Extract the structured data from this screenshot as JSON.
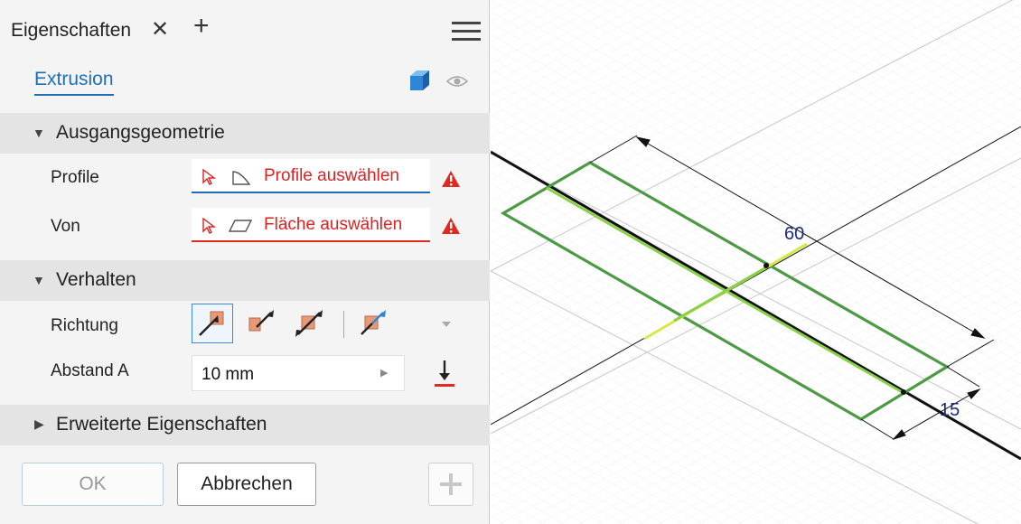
{
  "panel": {
    "tab_title": "Eigenschaften",
    "close_icon": "close-icon",
    "add_icon": "plus-icon",
    "menu_icon": "hamburger-menu-icon",
    "feature_tab": "Extrusion",
    "accent_color": "#1e6fb8",
    "error_color": "#dd2222"
  },
  "sections": {
    "input_geometry": {
      "title": "Ausgangsgeometrie",
      "profile_label": "Profile",
      "profile_value": "Profile auswählen",
      "from_label": "Von",
      "from_value": "Fläche auswählen"
    },
    "behavior": {
      "title": "Verhalten",
      "direction_label": "Richtung",
      "distance_label": "Abstand A",
      "distance_value": "10 mm"
    },
    "advanced": {
      "title": "Erweiterte Eigenschaften"
    }
  },
  "buttons": {
    "ok": "OK",
    "cancel": "Abbrechen"
  },
  "viewport": {
    "dimension_length": "60",
    "dimension_width": "15"
  }
}
